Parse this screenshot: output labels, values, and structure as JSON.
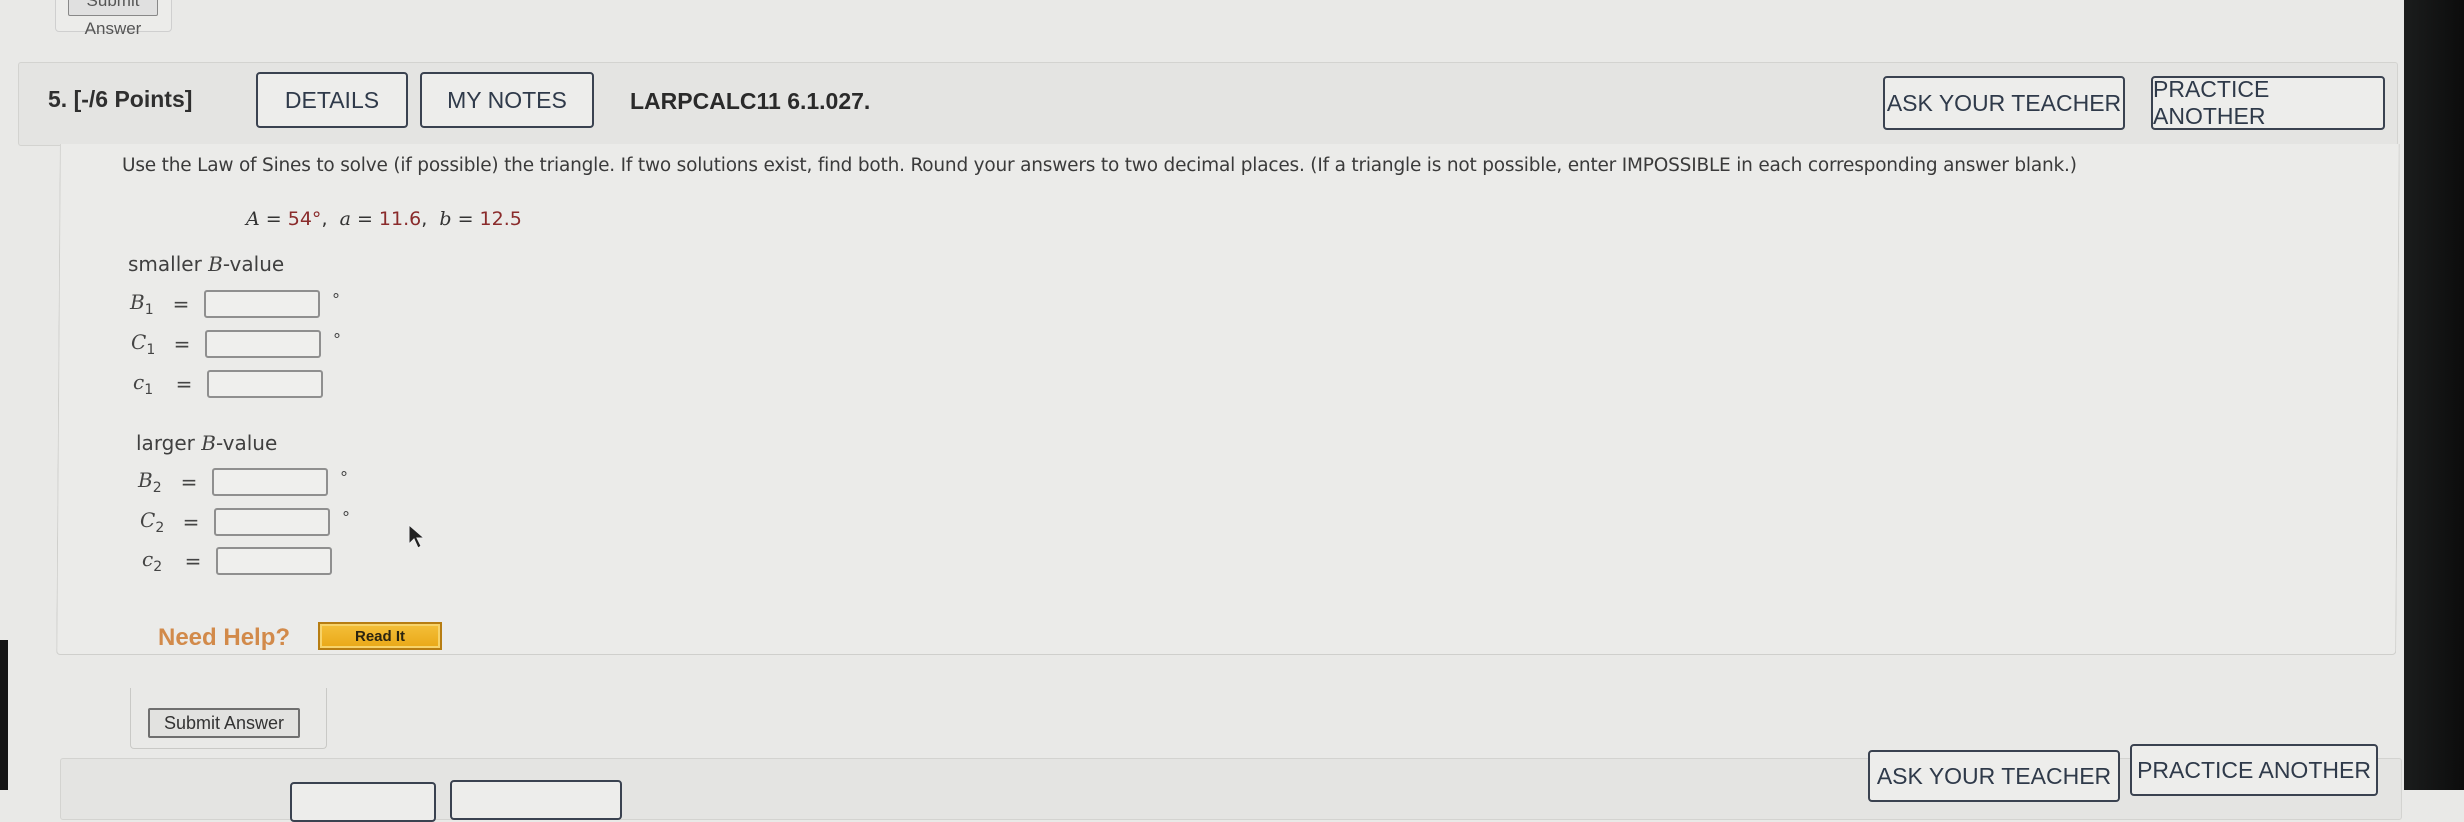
{
  "previous_question": {
    "submit_label": "Submit Answer"
  },
  "question": {
    "number_label": "5.",
    "points_label": "[-/6 Points]",
    "details_button": "DETAILS",
    "my_notes_button": "MY NOTES",
    "code": "LARPCALC11 6.1.027.",
    "ask_teacher_button": "ASK YOUR TEACHER",
    "practice_another_button": "PRACTICE ANOTHER",
    "instructions": "Use the Law of Sines to solve (if possible) the triangle. If two solutions exist, find both. Round your answers to two decimal places. (If a triangle is not possible, enter IMPOSSIBLE in each corresponding answer blank.)",
    "given": {
      "A_label": "A",
      "A_value": "54°",
      "a_label": "a",
      "a_value": "11.6",
      "b_label": "b",
      "b_value": "12.5",
      "equals": "="
    },
    "groups": [
      {
        "label_prefix": "smaller ",
        "label_var": "B",
        "label_suffix": "-value",
        "rows": [
          {
            "var": "B",
            "sub": "1",
            "value": "",
            "unit": "°"
          },
          {
            "var": "C",
            "sub": "1",
            "value": "",
            "unit": "°"
          },
          {
            "var": "c",
            "sub": "1",
            "value": "",
            "unit": ""
          }
        ]
      },
      {
        "label_prefix": "larger ",
        "label_var": "B",
        "label_suffix": "-value",
        "rows": [
          {
            "var": "B",
            "sub": "2",
            "value": "",
            "unit": "°"
          },
          {
            "var": "C",
            "sub": "2",
            "value": "",
            "unit": "°"
          },
          {
            "var": "c",
            "sub": "2",
            "value": "",
            "unit": ""
          }
        ]
      }
    ],
    "need_help_label": "Need Help?",
    "read_it_button": "Read It",
    "submit_label": "Submit Answer"
  },
  "next_question": {
    "ask_teacher_button": "ASK YOUR TEACHER",
    "practice_another_button": "PRACTICE ANOTHER"
  },
  "colors": {
    "given_value": "#8a2b2b",
    "need_help": "#d28a4a",
    "read_it_bg": "#f0b429",
    "button_border": "#3a4250"
  }
}
